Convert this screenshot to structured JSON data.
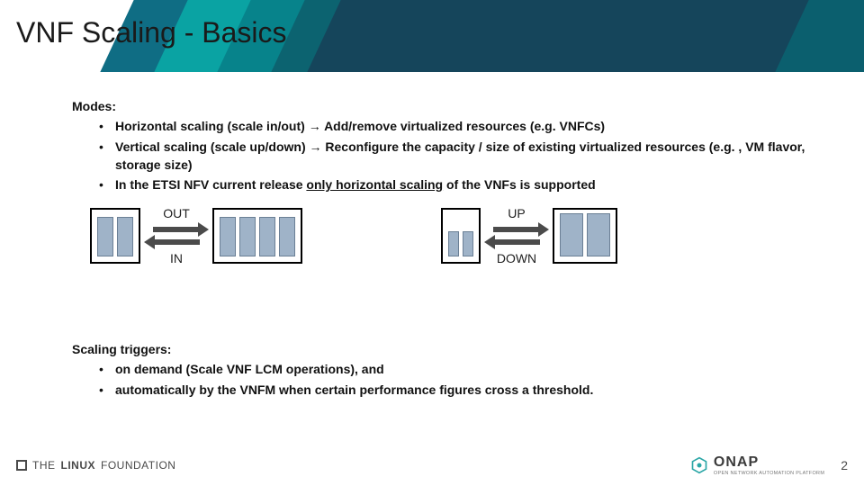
{
  "title": "VNF Scaling - Basics",
  "modes": {
    "heading": "Modes:",
    "items": [
      {
        "prefix": "Horizontal scaling (scale in/out) ",
        "arrow": "→",
        "rest": " Add/remove virtualized resources (e.g. VNFCs)"
      },
      {
        "prefix": "Vertical scaling (scale up/down) ",
        "arrow": "→",
        "rest": " Reconfigure the capacity / size of existing virtualized resources (e.g. , VM flavor, storage size)"
      },
      {
        "prefix": "In the ETSI NFV current release ",
        "underline": "only horizontal scaling",
        "rest2": " of the VNFs is supported"
      }
    ]
  },
  "diagram": {
    "horizontal": {
      "top": "OUT",
      "bottom": "IN"
    },
    "vertical": {
      "top": "UP",
      "bottom": "DOWN"
    }
  },
  "triggers": {
    "heading": "Scaling triggers:",
    "items": [
      "on demand (Scale VNF LCM operations), and",
      "automatically by the VNFM when certain performance figures cross a threshold."
    ]
  },
  "footer": {
    "leftA": "THE",
    "leftB": "LINUX",
    "leftC": "FOUNDATION",
    "brand": "ONAP",
    "brandSub": "OPEN NETWORK AUTOMATION PLATFORM",
    "page": "2"
  }
}
